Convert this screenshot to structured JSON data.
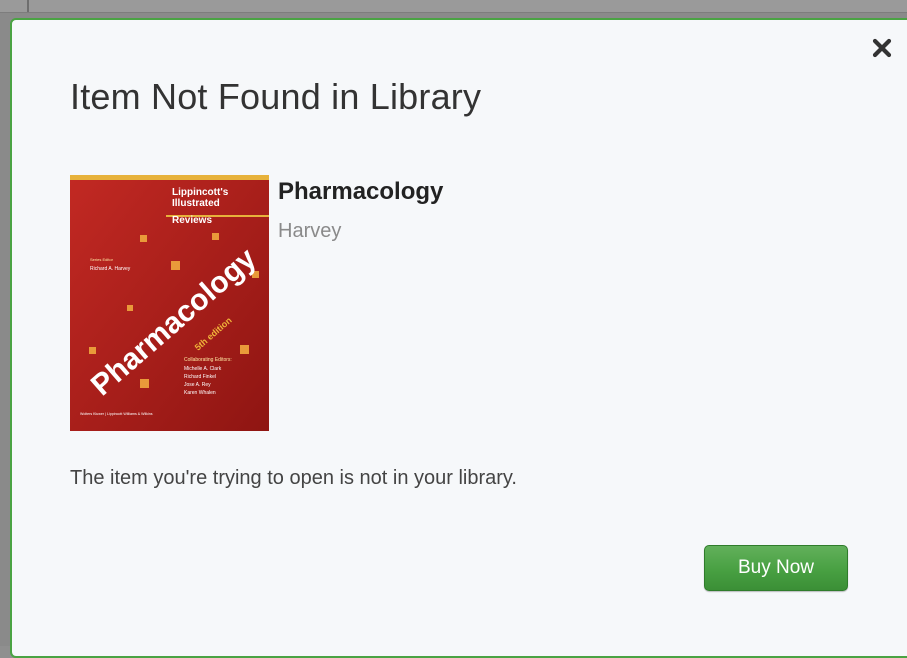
{
  "dialog": {
    "title": "Item Not Found in Library",
    "close_icon": "close-icon",
    "message": "The item you're trying to open is not in your library.",
    "buy_label": "Buy Now",
    "accent_color": "#4aa343"
  },
  "book": {
    "title": "Pharmacology",
    "author": "Harvey",
    "cover": {
      "series": [
        "Lippincott's",
        "Illustrated",
        "Reviews"
      ],
      "editor_label": "Series Editor",
      "editor": "Richard A. Harvey",
      "big_title": "Pharmacology",
      "edition": "5th edition",
      "collab_label": "Collaborating Editors:",
      "collaborators": [
        "Michelle A. Clark",
        "Richard Finkel",
        "Jose A. Rey",
        "Karen Whalen"
      ],
      "publisher": "Wolters Kluwer | Lippincott Williams & Wilkins",
      "cover_color": "#b3211d"
    }
  }
}
